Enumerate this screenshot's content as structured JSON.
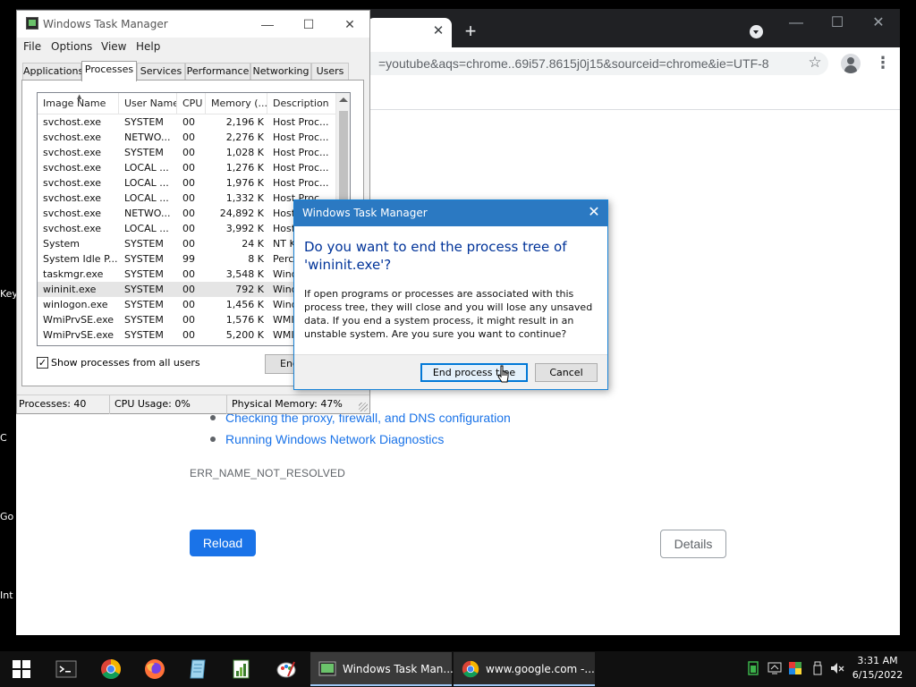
{
  "desktop": {
    "edge_fragments": [
      "Key",
      "C",
      "Go",
      "Int"
    ]
  },
  "chrome": {
    "new_tab_symbol": "+",
    "tab_close_symbol": "✕",
    "omnibox_text": "=youtube&aqs=chrome..69i57.8615j0j15&sourceid=chrome&ie=UTF-8",
    "error_links": [
      "Checking the proxy, firewall, and DNS configuration",
      "Running Windows Network Diagnostics"
    ],
    "error_code": "ERR_NAME_NOT_RESOLVED",
    "reload_label": "Reload",
    "details_label": "Details"
  },
  "taskmgr": {
    "title": "Windows Task Manager",
    "menu": [
      "File",
      "Options",
      "View",
      "Help"
    ],
    "tabs": [
      "Applications",
      "Processes",
      "Services",
      "Performance",
      "Networking",
      "Users"
    ],
    "active_tab": "Processes",
    "columns": [
      "Image Name",
      "User Name",
      "CPU",
      "Memory (...",
      "Description"
    ],
    "rows": [
      {
        "image": "svchost.exe",
        "user": "SYSTEM",
        "cpu": "00",
        "mem": "2,196 K",
        "desc": "Host Proc..."
      },
      {
        "image": "svchost.exe",
        "user": "NETWO...",
        "cpu": "00",
        "mem": "2,276 K",
        "desc": "Host Proc..."
      },
      {
        "image": "svchost.exe",
        "user": "SYSTEM",
        "cpu": "00",
        "mem": "1,028 K",
        "desc": "Host Proc..."
      },
      {
        "image": "svchost.exe",
        "user": "LOCAL ...",
        "cpu": "00",
        "mem": "1,276 K",
        "desc": "Host Proc..."
      },
      {
        "image": "svchost.exe",
        "user": "LOCAL ...",
        "cpu": "00",
        "mem": "1,976 K",
        "desc": "Host Proc..."
      },
      {
        "image": "svchost.exe",
        "user": "LOCAL ...",
        "cpu": "00",
        "mem": "1,332 K",
        "desc": "Host Proc..."
      },
      {
        "image": "svchost.exe",
        "user": "NETWO...",
        "cpu": "00",
        "mem": "24,892 K",
        "desc": "Host Proc..."
      },
      {
        "image": "svchost.exe",
        "user": "LOCAL ...",
        "cpu": "00",
        "mem": "3,992 K",
        "desc": "Host Proc..."
      },
      {
        "image": "System",
        "user": "SYSTEM",
        "cpu": "00",
        "mem": "24 K",
        "desc": "NT Kernel..."
      },
      {
        "image": "System Idle P...",
        "user": "SYSTEM",
        "cpu": "99",
        "mem": "8 K",
        "desc": "Percentage..."
      },
      {
        "image": "taskmgr.exe",
        "user": "SYSTEM",
        "cpu": "00",
        "mem": "3,548 K",
        "desc": "Windows..."
      },
      {
        "image": "wininit.exe",
        "user": "SYSTEM",
        "cpu": "00",
        "mem": "792 K",
        "desc": "Windows..."
      },
      {
        "image": "winlogon.exe",
        "user": "SYSTEM",
        "cpu": "00",
        "mem": "1,456 K",
        "desc": "Windows..."
      },
      {
        "image": "WmiPrvSE.exe",
        "user": "SYSTEM",
        "cpu": "00",
        "mem": "1,576 K",
        "desc": "WMI Provi..."
      },
      {
        "image": "WmiPrvSE.exe",
        "user": "SYSTEM",
        "cpu": "00",
        "mem": "5,200 K",
        "desc": "WMI Provi..."
      }
    ],
    "selected_row": 11,
    "show_all_label": "Show processes from all users",
    "show_all_checked": true,
    "end_process_label": "End Process",
    "status": {
      "processes": "Processes: 40",
      "cpu": "CPU Usage: 0%",
      "memory": "Physical Memory: 47%"
    }
  },
  "dialog": {
    "title": "Windows Task Manager",
    "main_instruction": "Do you want to end the process tree of 'wininit.exe'?",
    "message": "If open programs or processes are associated with this process tree, they will close and you will lose any unsaved data. If you end a system process, it might result in an unstable system. Are you sure you want to continue?",
    "primary_button": "End process tree",
    "secondary_button": "Cancel"
  },
  "taskbar": {
    "windows": [
      {
        "label": "Windows Task Man...",
        "active": true
      },
      {
        "label": "www.google.com -...",
        "active": false
      }
    ],
    "time": "3:31 AM",
    "date": "6/15/2022"
  },
  "colors": {
    "chrome_blue": "#1a73e8",
    "dialog_title": "#2b79c2",
    "instruction_text": "#003399"
  }
}
